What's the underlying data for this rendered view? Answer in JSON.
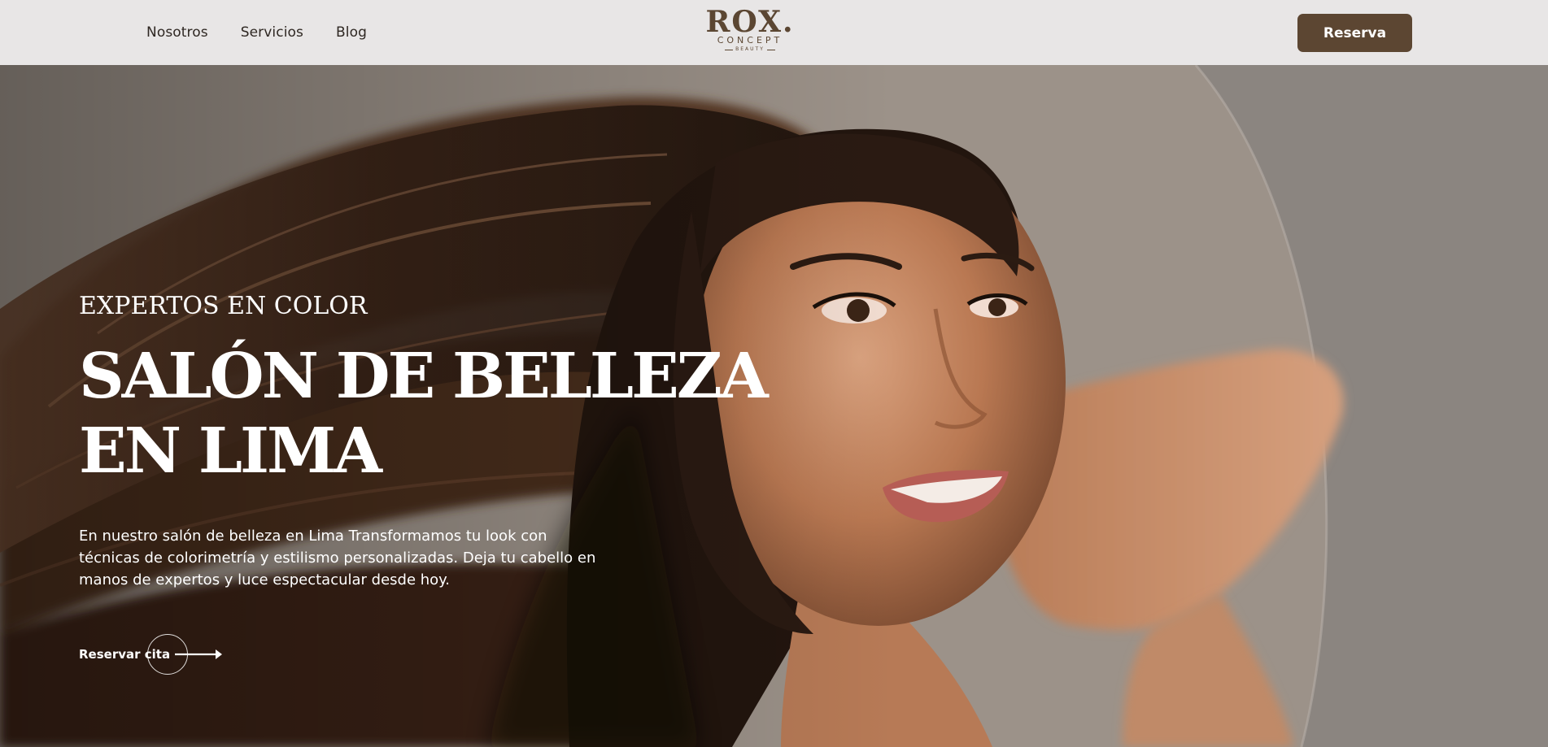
{
  "header": {
    "nav": [
      {
        "label": "Nosotros"
      },
      {
        "label": "Servicios"
      },
      {
        "label": "Blog"
      }
    ],
    "logo": {
      "main": "ROX.",
      "sub": "CONCEPT",
      "tiny": "BEAUTY"
    },
    "reserve_label": "Reserva"
  },
  "hero": {
    "eyebrow": "EXPERTOS EN COLOR",
    "headline_line1": "SALÓN DE BELLEZA",
    "headline_line2": "EN LIMA",
    "description": "En nuestro salón de belleza en Lima Transformamos tu look con técnicas de colorimetría y estilismo personalizadas. Deja tu cabello en manos de expertos y luce espectacular desde hoy.",
    "cta_label": "Reservar cita"
  },
  "colors": {
    "brand_brown": "#5c4632",
    "header_bg": "#e8e6e6",
    "hero_text": "#ffffff"
  }
}
